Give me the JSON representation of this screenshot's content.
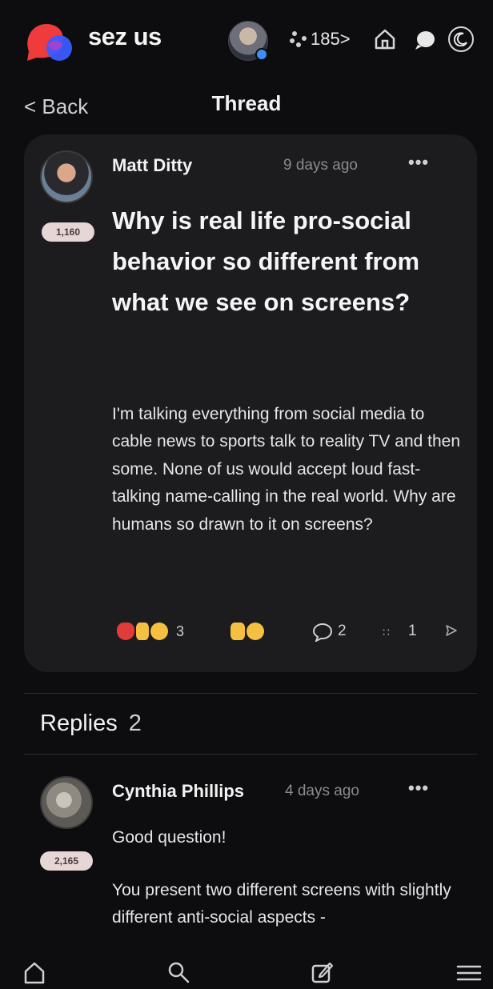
{
  "app": {
    "brand": "sez us",
    "points_link": "185>",
    "brand_colors": {
      "red": "#ef3b3b",
      "blue": "#3b5bff"
    }
  },
  "header": {
    "back_label": "< Back",
    "title": "Thread"
  },
  "post": {
    "author": "Matt Ditty",
    "time": "9 days ago",
    "score": "1,160",
    "more_label": "•••",
    "title": "Why is real life pro-social behavior so different from what we see on screens?",
    "body": "I'm talking everything from social media to cable news to sports talk to reality TV and then some. None of us would accept loud fast-talking name-calling in the real world. Why are humans so drawn to it on screens?",
    "reactions": [
      {
        "icons": [
          "heart-broken",
          "thumbs-down",
          "thinking-face"
        ],
        "count": "3"
      },
      {
        "icons": [
          "thumbs-down",
          "smile-face"
        ],
        "count": ""
      }
    ],
    "comments": "2",
    "views": "1"
  },
  "replies": {
    "label": "Replies",
    "count": "2",
    "items": [
      {
        "author": "Cynthia Phillips",
        "time": "4 days ago",
        "score": "2,165",
        "more_label": "•••",
        "paragraphs": [
          "Good question!",
          "You present two different screens with slightly different anti-social aspects -"
        ]
      }
    ]
  }
}
